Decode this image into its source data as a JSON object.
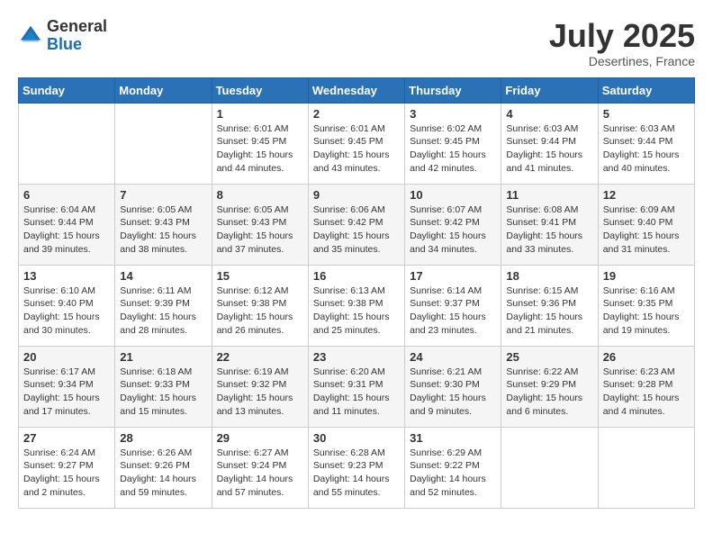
{
  "logo": {
    "general": "General",
    "blue": "Blue"
  },
  "title": "July 2025",
  "subtitle": "Desertines, France",
  "headers": [
    "Sunday",
    "Monday",
    "Tuesday",
    "Wednesday",
    "Thursday",
    "Friday",
    "Saturday"
  ],
  "weeks": [
    [
      {
        "day": "",
        "info": ""
      },
      {
        "day": "",
        "info": ""
      },
      {
        "day": "1",
        "info": "Sunrise: 6:01 AM\nSunset: 9:45 PM\nDaylight: 15 hours\nand 44 minutes."
      },
      {
        "day": "2",
        "info": "Sunrise: 6:01 AM\nSunset: 9:45 PM\nDaylight: 15 hours\nand 43 minutes."
      },
      {
        "day": "3",
        "info": "Sunrise: 6:02 AM\nSunset: 9:45 PM\nDaylight: 15 hours\nand 42 minutes."
      },
      {
        "day": "4",
        "info": "Sunrise: 6:03 AM\nSunset: 9:44 PM\nDaylight: 15 hours\nand 41 minutes."
      },
      {
        "day": "5",
        "info": "Sunrise: 6:03 AM\nSunset: 9:44 PM\nDaylight: 15 hours\nand 40 minutes."
      }
    ],
    [
      {
        "day": "6",
        "info": "Sunrise: 6:04 AM\nSunset: 9:44 PM\nDaylight: 15 hours\nand 39 minutes."
      },
      {
        "day": "7",
        "info": "Sunrise: 6:05 AM\nSunset: 9:43 PM\nDaylight: 15 hours\nand 38 minutes."
      },
      {
        "day": "8",
        "info": "Sunrise: 6:05 AM\nSunset: 9:43 PM\nDaylight: 15 hours\nand 37 minutes."
      },
      {
        "day": "9",
        "info": "Sunrise: 6:06 AM\nSunset: 9:42 PM\nDaylight: 15 hours\nand 35 minutes."
      },
      {
        "day": "10",
        "info": "Sunrise: 6:07 AM\nSunset: 9:42 PM\nDaylight: 15 hours\nand 34 minutes."
      },
      {
        "day": "11",
        "info": "Sunrise: 6:08 AM\nSunset: 9:41 PM\nDaylight: 15 hours\nand 33 minutes."
      },
      {
        "day": "12",
        "info": "Sunrise: 6:09 AM\nSunset: 9:40 PM\nDaylight: 15 hours\nand 31 minutes."
      }
    ],
    [
      {
        "day": "13",
        "info": "Sunrise: 6:10 AM\nSunset: 9:40 PM\nDaylight: 15 hours\nand 30 minutes."
      },
      {
        "day": "14",
        "info": "Sunrise: 6:11 AM\nSunset: 9:39 PM\nDaylight: 15 hours\nand 28 minutes."
      },
      {
        "day": "15",
        "info": "Sunrise: 6:12 AM\nSunset: 9:38 PM\nDaylight: 15 hours\nand 26 minutes."
      },
      {
        "day": "16",
        "info": "Sunrise: 6:13 AM\nSunset: 9:38 PM\nDaylight: 15 hours\nand 25 minutes."
      },
      {
        "day": "17",
        "info": "Sunrise: 6:14 AM\nSunset: 9:37 PM\nDaylight: 15 hours\nand 23 minutes."
      },
      {
        "day": "18",
        "info": "Sunrise: 6:15 AM\nSunset: 9:36 PM\nDaylight: 15 hours\nand 21 minutes."
      },
      {
        "day": "19",
        "info": "Sunrise: 6:16 AM\nSunset: 9:35 PM\nDaylight: 15 hours\nand 19 minutes."
      }
    ],
    [
      {
        "day": "20",
        "info": "Sunrise: 6:17 AM\nSunset: 9:34 PM\nDaylight: 15 hours\nand 17 minutes."
      },
      {
        "day": "21",
        "info": "Sunrise: 6:18 AM\nSunset: 9:33 PM\nDaylight: 15 hours\nand 15 minutes."
      },
      {
        "day": "22",
        "info": "Sunrise: 6:19 AM\nSunset: 9:32 PM\nDaylight: 15 hours\nand 13 minutes."
      },
      {
        "day": "23",
        "info": "Sunrise: 6:20 AM\nSunset: 9:31 PM\nDaylight: 15 hours\nand 11 minutes."
      },
      {
        "day": "24",
        "info": "Sunrise: 6:21 AM\nSunset: 9:30 PM\nDaylight: 15 hours\nand 9 minutes."
      },
      {
        "day": "25",
        "info": "Sunrise: 6:22 AM\nSunset: 9:29 PM\nDaylight: 15 hours\nand 6 minutes."
      },
      {
        "day": "26",
        "info": "Sunrise: 6:23 AM\nSunset: 9:28 PM\nDaylight: 15 hours\nand 4 minutes."
      }
    ],
    [
      {
        "day": "27",
        "info": "Sunrise: 6:24 AM\nSunset: 9:27 PM\nDaylight: 15 hours\nand 2 minutes."
      },
      {
        "day": "28",
        "info": "Sunrise: 6:26 AM\nSunset: 9:26 PM\nDaylight: 14 hours\nand 59 minutes."
      },
      {
        "day": "29",
        "info": "Sunrise: 6:27 AM\nSunset: 9:24 PM\nDaylight: 14 hours\nand 57 minutes."
      },
      {
        "day": "30",
        "info": "Sunrise: 6:28 AM\nSunset: 9:23 PM\nDaylight: 14 hours\nand 55 minutes."
      },
      {
        "day": "31",
        "info": "Sunrise: 6:29 AM\nSunset: 9:22 PM\nDaylight: 14 hours\nand 52 minutes."
      },
      {
        "day": "",
        "info": ""
      },
      {
        "day": "",
        "info": ""
      }
    ]
  ]
}
